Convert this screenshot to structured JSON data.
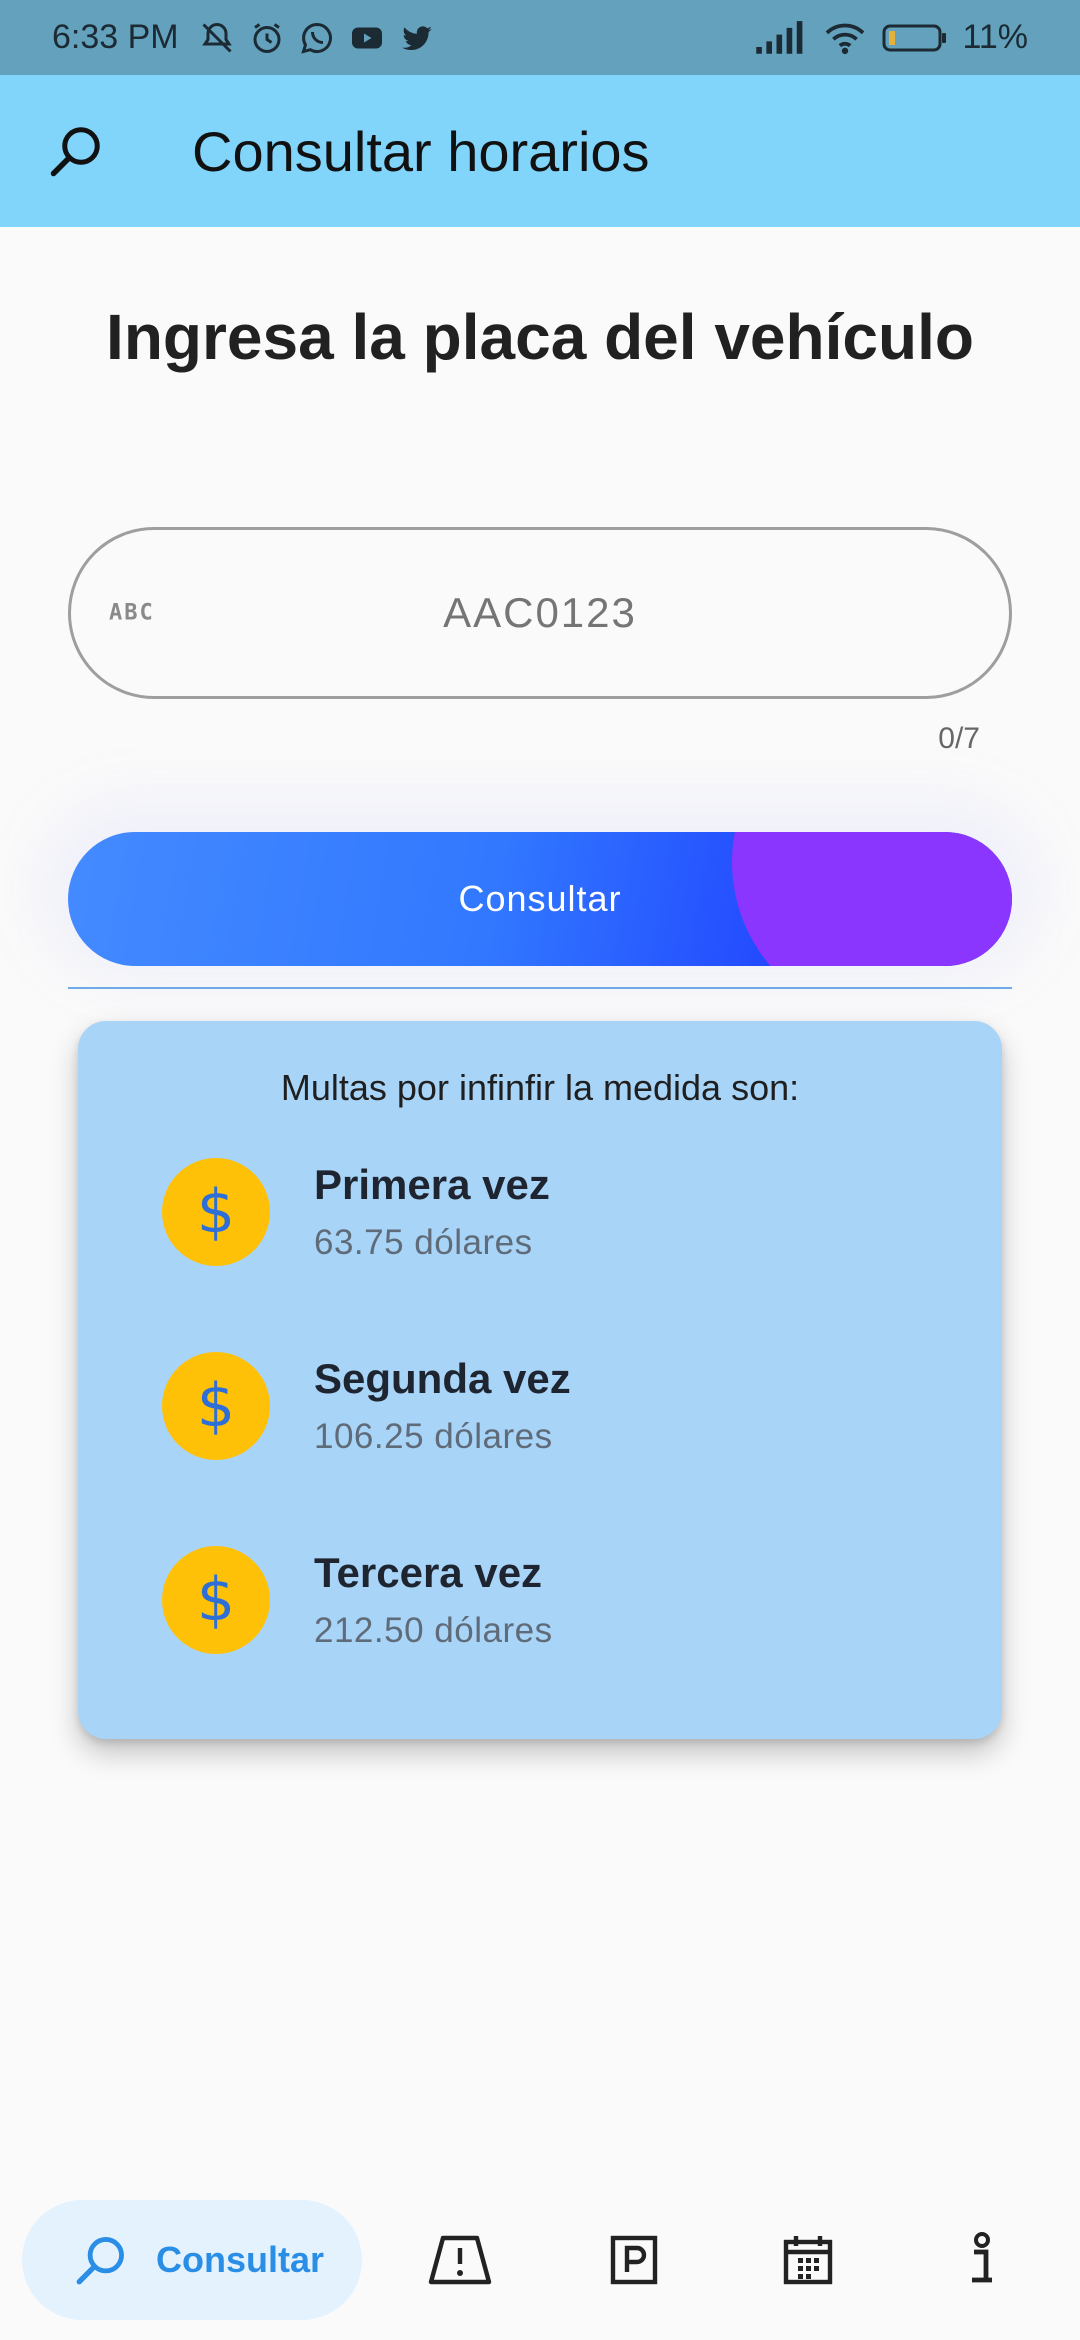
{
  "status_bar": {
    "time": "6:33 PM",
    "battery": "11%",
    "icons": [
      "muted-alarm-icon",
      "alarm-icon",
      "whatsapp-icon",
      "youtube-icon",
      "twitter-icon",
      "signal-icon",
      "wifi-icon",
      "battery-icon"
    ]
  },
  "app_bar": {
    "title": "Consultar horarios",
    "search_icon": "search-icon"
  },
  "main": {
    "heading": "Ingresa la placa del vehículo",
    "plate_input": {
      "value": "",
      "placeholder": "AAC0123",
      "prefix_icon_text": "ABC",
      "counter": "0/7"
    },
    "consult_button": "Consultar"
  },
  "fines_card": {
    "title": "Multas por infinfir la medida son:",
    "items": [
      {
        "label": "Primera vez",
        "amount": "63.75 dólares",
        "icon": "$"
      },
      {
        "label": "Segunda vez",
        "amount": "106.25 dólares",
        "icon": "$"
      },
      {
        "label": "Tercera vez",
        "amount": "212.50 dólares",
        "icon": "$"
      }
    ]
  },
  "bottom_nav": {
    "active_label": "Consultar",
    "items": [
      "search-icon",
      "road-sign-icon",
      "parking-icon",
      "calendar-icon",
      "info-icon"
    ]
  },
  "colors": {
    "app_bar": "#81d4fa",
    "status_bar": "#64a1bd",
    "card": "#a8d4f8",
    "coin": "#ffc107",
    "accent": "#2a8ee6"
  }
}
